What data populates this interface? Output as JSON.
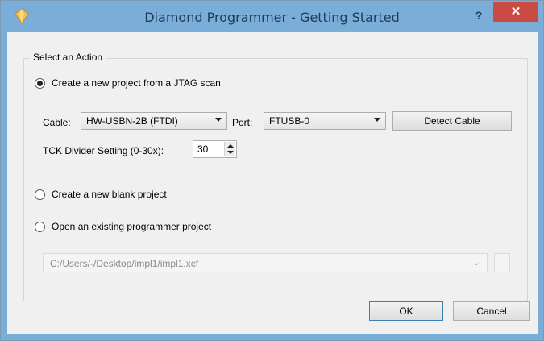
{
  "window": {
    "title": "Diamond Programmer - Getting Started",
    "help_label": "?",
    "close_label": "✕"
  },
  "group": {
    "title": "Select an Action"
  },
  "actions": {
    "jtag_scan": "Create a new project from a JTAG scan",
    "blank_project": "Create a new blank project",
    "open_existing": "Open an existing programmer project"
  },
  "jtag": {
    "cable_label": "Cable:",
    "cable_value": "HW-USBN-2B (FTDI)",
    "port_label": "Port:",
    "port_value": "FTUSB-0",
    "detect_label": "Detect Cable",
    "tck_label": "TCK Divider Setting (0-30x):",
    "tck_value": "30"
  },
  "open_project": {
    "path_value": "C:/Users/-/Desktop/impl1/impl1.xcf",
    "browse_label": "..."
  },
  "footer": {
    "ok_label": "OK",
    "cancel_label": "Cancel"
  },
  "state": {
    "selected_action": "jtag_scan"
  },
  "colors": {
    "title_bar": "#7aaed9",
    "close_button": "#c94b44",
    "dialog_bg": "#f0f0f0"
  }
}
